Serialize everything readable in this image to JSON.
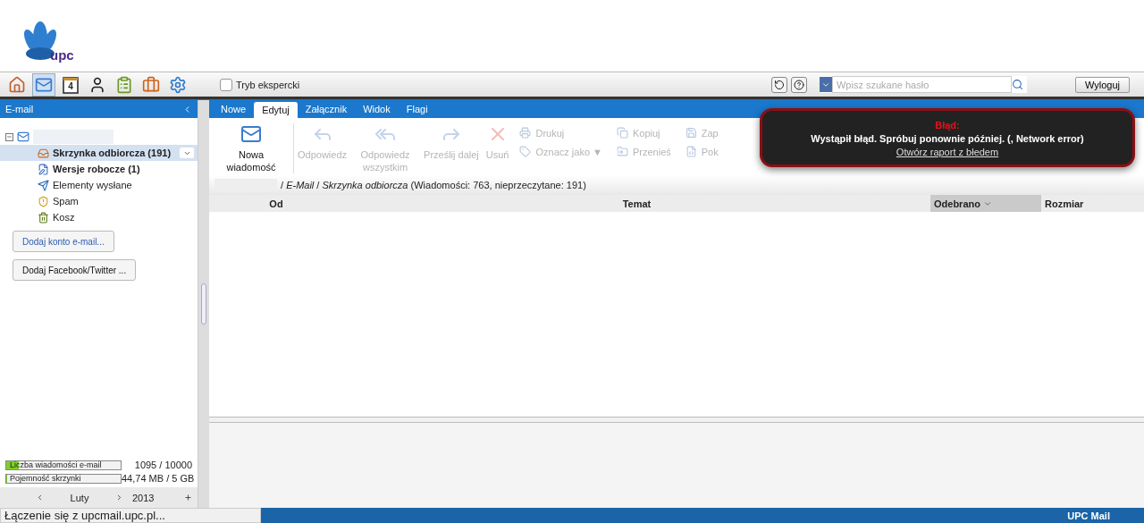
{
  "logo": {
    "text": "upc"
  },
  "toolbar": {
    "apps": [
      {
        "kind": "home",
        "selected": false
      },
      {
        "kind": "mail",
        "selected": true
      },
      {
        "kind": "calendar",
        "selected": false,
        "label": "4"
      },
      {
        "kind": "contacts",
        "selected": false
      },
      {
        "kind": "tasks",
        "selected": false
      },
      {
        "kind": "briefcase",
        "selected": false
      },
      {
        "kind": "settings",
        "selected": false
      }
    ],
    "expert_mode": {
      "label": "Tryb ekspercki",
      "checked": false
    },
    "search": {
      "placeholder": "Wpisz szukane hasło"
    },
    "logout": "Wyloguj"
  },
  "sidebar": {
    "title": "E-mail",
    "account": {
      "expanded": true
    },
    "folders": [
      {
        "kind": "inbox",
        "label": "Skrzynka odbiorcza (191)",
        "unread": true,
        "selected": true
      },
      {
        "kind": "drafts",
        "label": "Wersje robocze (1)",
        "unread": true,
        "selected": false
      },
      {
        "kind": "sent",
        "label": "Elementy wysłane",
        "unread": false,
        "selected": false
      },
      {
        "kind": "spam",
        "label": "Spam",
        "unread": false,
        "selected": false
      },
      {
        "kind": "trash",
        "label": "Kosz",
        "unread": false,
        "selected": false
      }
    ],
    "buttons": [
      "Dodaj konto e-mail...",
      "Dodaj Facebook/Twitter ..."
    ],
    "meters": [
      {
        "label": "Liczba wiadomości e-mail",
        "level": 0.11,
        "reading": "1095 / 10000"
      },
      {
        "label": "Pojemność skrzynki",
        "level": 0.01,
        "reading": "44,74 MB / 5 GB"
      }
    ],
    "calendar": {
      "month": "Luty",
      "year": "2013"
    }
  },
  "tabs": [
    {
      "label": "Nowe",
      "selected": false
    },
    {
      "label": "Edytuj",
      "selected": true
    },
    {
      "label": "Załącznik",
      "selected": false
    },
    {
      "label": "Widok",
      "selected": false
    },
    {
      "label": "Flagi",
      "selected": false
    }
  ],
  "ribbon": [
    {
      "kind": "large",
      "label": "Nowa wiadomość",
      "disabled": false
    },
    {
      "kind": "large",
      "label": "Odpowiedz",
      "disabled": true
    },
    {
      "kind": "large",
      "label": "Odpowiedz wszystkim",
      "disabled": true
    },
    {
      "kind": "large",
      "label": "Prześlij dalej",
      "disabled": true
    },
    {
      "kind": "large",
      "label": "Usuń",
      "disabled": true
    },
    {
      "kind": "small",
      "items": [
        {
          "label": "Drukuj",
          "disabled": true
        },
        {
          "label": "Oznacz jako ▼",
          "disabled": true
        }
      ]
    },
    {
      "kind": "small",
      "items": [
        {
          "label": "Kopiuj",
          "disabled": true
        },
        {
          "label": "Przenieś",
          "disabled": true
        }
      ]
    },
    {
      "kind": "small",
      "items": [
        {
          "label": "Zap",
          "disabled": true
        },
        {
          "label": "Pok",
          "disabled": true
        }
      ]
    }
  ],
  "breadcrumb": {
    "path": "/ *E-Mail* / *Skrzynka odbiorcza*",
    "counts": "(Wiadomości: 763, nieprzeczytane: 191)"
  },
  "columns": [
    {
      "label": "Od",
      "sorted": false
    },
    {
      "label": "Temat",
      "sorted": false
    },
    {
      "label": "Odebrano",
      "sorted": true
    },
    {
      "label": "Rozmiar",
      "sorted": false
    }
  ],
  "error": {
    "title": "Błąd:",
    "message": "Wystąpił błąd. Spróbuj ponownie później. (, Network error)",
    "link": "Otwórz raport z błedem"
  },
  "status_bar": {
    "loading": "Łączenie się z upcmail.upc.pl...",
    "brand": "UPC Mail"
  }
}
